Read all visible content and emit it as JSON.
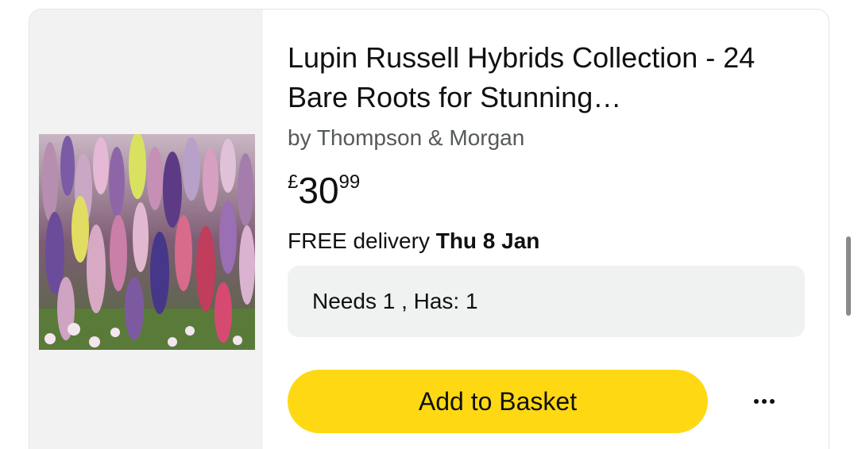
{
  "product": {
    "title": "Lupin Russell Hybrids Collection - 24 Bare Roots for Stunning…",
    "brand": "by Thompson & Morgan",
    "image_alt": "lupin-flowers-image",
    "price": {
      "symbol": "£",
      "whole": "30",
      "fraction": "99"
    },
    "delivery": {
      "prefix": "FREE delivery ",
      "date": "Thu 8 Jan"
    },
    "needs": "Needs 1 , Has: 1"
  },
  "actions": {
    "add_to_basket": "Add to Basket",
    "more_icon": "more-horizontal-icon"
  },
  "colors": {
    "button_yellow": "#ffd814",
    "panel_grey": "#f2f2f2",
    "needs_box_bg": "#f0f2f2",
    "text_dark": "#0f1111",
    "text_muted": "#565959"
  }
}
